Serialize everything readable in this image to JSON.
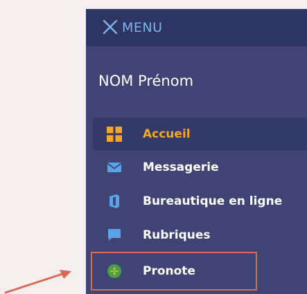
{
  "menu": {
    "title": "MENU",
    "close_icon": "close-icon"
  },
  "user": {
    "name": "NOM Prénom"
  },
  "nav": {
    "items": [
      {
        "label": "Accueil",
        "icon": "grid-icon",
        "active": true
      },
      {
        "label": "Messagerie",
        "icon": "envelope-icon",
        "active": false
      },
      {
        "label": "Bureautique en ligne",
        "icon": "office-icon",
        "active": false
      },
      {
        "label": "Rubriques",
        "icon": "chat-icon",
        "active": false
      },
      {
        "label": "Pronote",
        "icon": "pronote-icon",
        "active": false
      }
    ]
  },
  "colors": {
    "panel": "#3f4474",
    "header": "#2f3562",
    "accent": "#f4a62a",
    "title_blue": "#7fb4ee",
    "icon_blue": "#5aa3e8",
    "highlight": "#d86a54"
  }
}
